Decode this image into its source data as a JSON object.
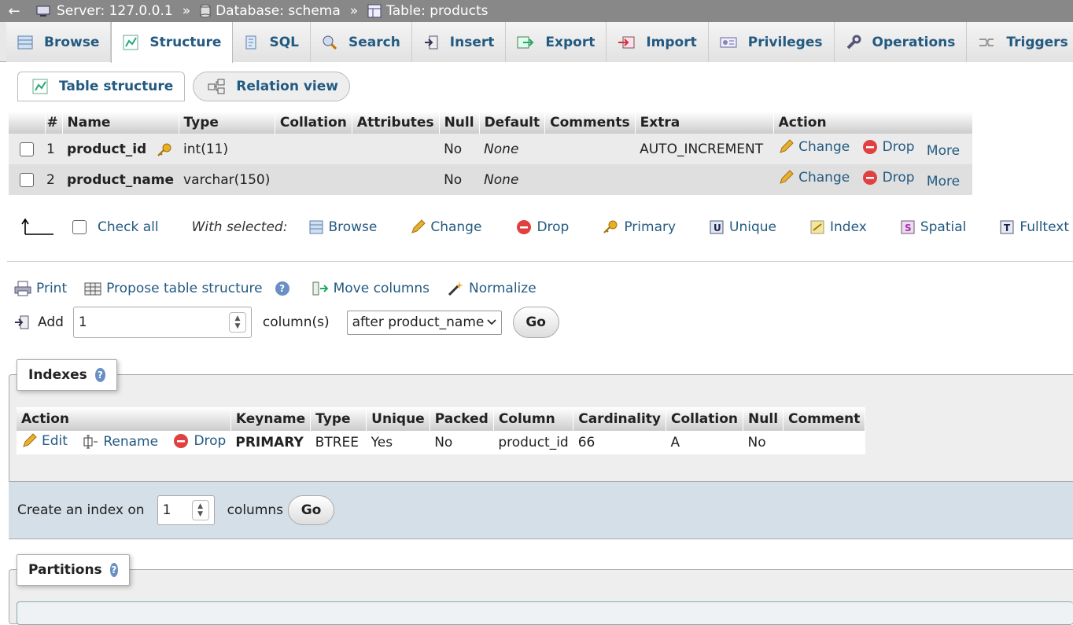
{
  "breadcrumb": {
    "back": "←",
    "server": "Server: 127.0.0.1",
    "database": "Database: schema",
    "table": "Table: products",
    "sep": "»"
  },
  "tabs": [
    {
      "label": "Browse",
      "icon": "browse-icon"
    },
    {
      "label": "Structure",
      "icon": "structure-icon",
      "active": true
    },
    {
      "label": "SQL",
      "icon": "sql-icon"
    },
    {
      "label": "Search",
      "icon": "search-icon"
    },
    {
      "label": "Insert",
      "icon": "insert-icon"
    },
    {
      "label": "Export",
      "icon": "export-icon"
    },
    {
      "label": "Import",
      "icon": "import-icon"
    },
    {
      "label": "Privileges",
      "icon": "privileges-icon"
    },
    {
      "label": "Operations",
      "icon": "operations-icon"
    },
    {
      "label": "Triggers",
      "icon": "triggers-icon"
    }
  ],
  "subtabs": {
    "table_structure": "Table structure",
    "relation_view": "Relation view"
  },
  "structure": {
    "headers": [
      "#",
      "Name",
      "Type",
      "Collation",
      "Attributes",
      "Null",
      "Default",
      "Comments",
      "Extra",
      "Action"
    ],
    "rows": [
      {
        "num": "1",
        "name": "product_id",
        "type": "int(11)",
        "collation": "",
        "attributes": "",
        "null": "No",
        "default": "None",
        "comments": "",
        "extra": "AUTO_INCREMENT"
      },
      {
        "num": "2",
        "name": "product_name",
        "type": "varchar(150)",
        "collation": "",
        "attributes": "",
        "null": "No",
        "default": "None",
        "comments": "",
        "extra": ""
      }
    ],
    "actions": {
      "change": "Change",
      "drop": "Drop",
      "more": "More"
    }
  },
  "with_selected": {
    "check_all": "Check all",
    "label": "With selected:",
    "browse": "Browse",
    "change": "Change",
    "drop": "Drop",
    "primary": "Primary",
    "unique": "Unique",
    "index": "Index",
    "spatial": "Spatial",
    "fulltext": "Fulltext"
  },
  "links": {
    "print": "Print",
    "propose": "Propose table structure",
    "move": "Move columns",
    "normalize": "Normalize"
  },
  "add": {
    "label": "Add",
    "value": "1",
    "columns": "column(s)",
    "position": "after product_name",
    "go": "Go"
  },
  "indexes": {
    "legend": "Indexes",
    "headers": [
      "Action",
      "Keyname",
      "Type",
      "Unique",
      "Packed",
      "Column",
      "Cardinality",
      "Collation",
      "Null",
      "Comment"
    ],
    "row": {
      "edit": "Edit",
      "rename": "Rename",
      "drop": "Drop",
      "keyname": "PRIMARY",
      "type": "BTREE",
      "unique": "Yes",
      "packed": "No",
      "column": "product_id",
      "cardinality": "66",
      "collation": "A",
      "null": "No",
      "comment": ""
    },
    "create_label": "Create an index on",
    "create_value": "1",
    "columns": "columns",
    "go": "Go"
  },
  "partitions": {
    "legend": "Partitions"
  },
  "colors": {
    "link": "#235a81",
    "topbar": "#888888",
    "drop": "#e04040",
    "help": "#6a8fc4"
  }
}
